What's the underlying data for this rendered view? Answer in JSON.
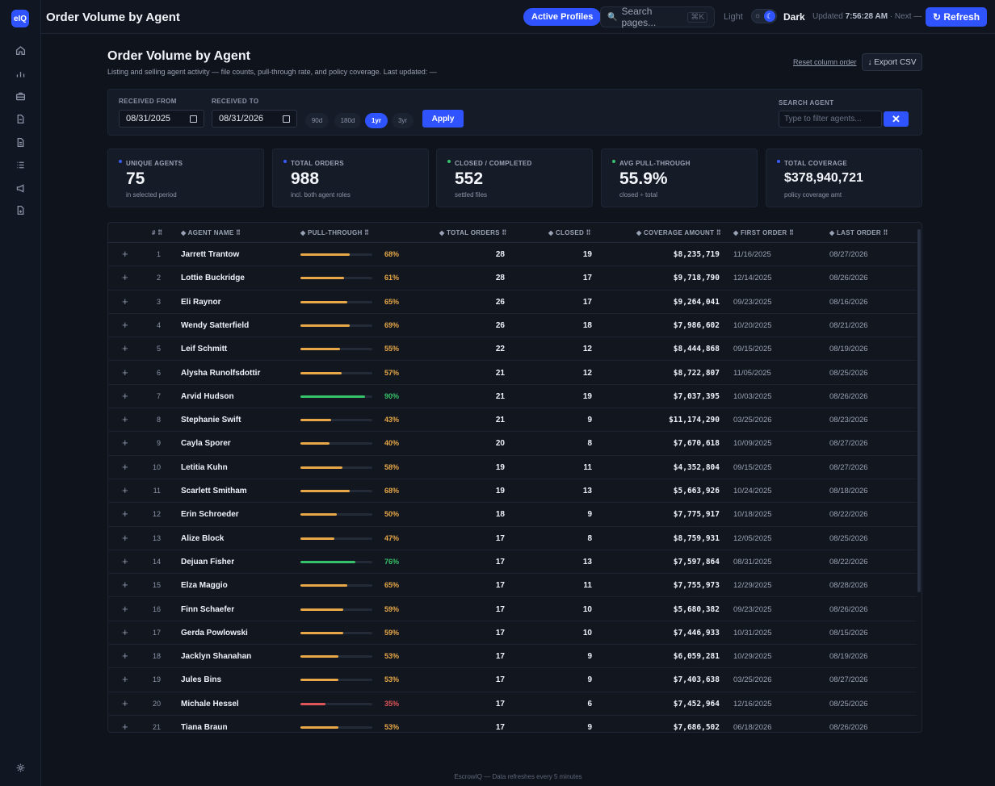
{
  "app": {
    "logo": "eIQ",
    "title": "Order Volume by Agent"
  },
  "sidebar": {
    "icons": [
      "home-icon",
      "chart-icon",
      "briefcase-icon",
      "file-icon",
      "document-icon",
      "list-icon",
      "megaphone-icon",
      "report-icon"
    ],
    "bottom_icon": "settings-icon"
  },
  "topbar": {
    "active_profiles_label": "Active Profiles",
    "search_placeholder": "Search pages...",
    "search_shortcut": "⌘K",
    "theme_light": "Light",
    "theme_dark": "Dark",
    "updated_prefix": "Updated",
    "updated_time": "7:56:28 AM",
    "updated_suffix": "· Next —",
    "refresh_label": "↻ Refresh"
  },
  "header": {
    "title": "Order Volume by Agent",
    "subtitle": "Listing and selling agent activity — file counts, pull-through rate, and policy coverage. Last updated: —",
    "reset_label": "Reset column order",
    "export_label": "↓ Export CSV"
  },
  "filters": {
    "from_label": "RECEIVED FROM",
    "from_value": "08/31/2025",
    "to_label": "RECEIVED TO",
    "to_value": "08/31/2026",
    "ranges": [
      "90d",
      "180d",
      "1yr",
      "3yr"
    ],
    "active_range": "1yr",
    "apply_label": "Apply",
    "search_label": "SEARCH AGENT",
    "search_placeholder": "Type to filter agents...",
    "clear_label": "✕"
  },
  "stats": [
    {
      "label": "UNIQUE AGENTS",
      "value": "75",
      "sub": "in selected period",
      "color": "#3b5bff"
    },
    {
      "label": "TOTAL ORDERS",
      "value": "988",
      "sub": "incl. both agent roles",
      "color": "#3b5bff"
    },
    {
      "label": "CLOSED / COMPLETED",
      "value": "552",
      "sub": "settled files",
      "color": "#36c26b"
    },
    {
      "label": "AVG PULL-THROUGH",
      "value": "55.9%",
      "sub": "closed ÷ total",
      "color": "#36c26b"
    },
    {
      "label": "TOTAL COVERAGE",
      "value": "$378,940,721",
      "sub": "policy coverage amt",
      "color": "#3b5bff"
    }
  ],
  "table": {
    "columns": [
      "# ⠿",
      "◆ AGENT NAME ⠿",
      "◆ PULL-THROUGH ⠿",
      "◆ TOTAL ORDERS ⠿",
      "◆ CLOSED ⠿",
      "◆ COVERAGE AMOUNT ⠿",
      "◆ FIRST ORDER ⠿",
      "◆ LAST ORDER ⠿"
    ],
    "expand_symbol": "+",
    "rows": [
      {
        "n": "1",
        "name": "Jarrett Trantow",
        "pct": 68,
        "pct_label": "68%",
        "total": "28",
        "closed": "19",
        "coverage": "$8,235,719",
        "first": "11/16/2025",
        "last": "08/27/2026"
      },
      {
        "n": "2",
        "name": "Lottie Buckridge",
        "pct": 61,
        "pct_label": "61%",
        "total": "28",
        "closed": "17",
        "coverage": "$9,718,790",
        "first": "12/14/2025",
        "last": "08/26/2026"
      },
      {
        "n": "3",
        "name": "Eli Raynor",
        "pct": 65,
        "pct_label": "65%",
        "total": "26",
        "closed": "17",
        "coverage": "$9,264,041",
        "first": "09/23/2025",
        "last": "08/16/2026"
      },
      {
        "n": "4",
        "name": "Wendy Satterfield",
        "pct": 69,
        "pct_label": "69%",
        "total": "26",
        "closed": "18",
        "coverage": "$7,986,602",
        "first": "10/20/2025",
        "last": "08/21/2026"
      },
      {
        "n": "5",
        "name": "Leif Schmitt",
        "pct": 55,
        "pct_label": "55%",
        "total": "22",
        "closed": "12",
        "coverage": "$8,444,868",
        "first": "09/15/2025",
        "last": "08/19/2026"
      },
      {
        "n": "6",
        "name": "Alysha Runolfsdottir",
        "pct": 57,
        "pct_label": "57%",
        "total": "21",
        "closed": "12",
        "coverage": "$8,722,807",
        "first": "11/05/2025",
        "last": "08/25/2026"
      },
      {
        "n": "7",
        "name": "Arvid Hudson",
        "pct": 90,
        "pct_label": "90%",
        "total": "21",
        "closed": "19",
        "coverage": "$7,037,395",
        "first": "10/03/2025",
        "last": "08/26/2026"
      },
      {
        "n": "8",
        "name": "Stephanie Swift",
        "pct": 43,
        "pct_label": "43%",
        "total": "21",
        "closed": "9",
        "coverage": "$11,174,290",
        "first": "03/25/2026",
        "last": "08/23/2026"
      },
      {
        "n": "9",
        "name": "Cayla Sporer",
        "pct": 40,
        "pct_label": "40%",
        "total": "20",
        "closed": "8",
        "coverage": "$7,670,618",
        "first": "10/09/2025",
        "last": "08/27/2026"
      },
      {
        "n": "10",
        "name": "Letitia Kuhn",
        "pct": 58,
        "pct_label": "58%",
        "total": "19",
        "closed": "11",
        "coverage": "$4,352,804",
        "first": "09/15/2025",
        "last": "08/27/2026"
      },
      {
        "n": "11",
        "name": "Scarlett Smitham",
        "pct": 68,
        "pct_label": "68%",
        "total": "19",
        "closed": "13",
        "coverage": "$5,663,926",
        "first": "10/24/2025",
        "last": "08/18/2026"
      },
      {
        "n": "12",
        "name": "Erin Schroeder",
        "pct": 50,
        "pct_label": "50%",
        "total": "18",
        "closed": "9",
        "coverage": "$7,775,917",
        "first": "10/18/2025",
        "last": "08/22/2026"
      },
      {
        "n": "13",
        "name": "Alize Block",
        "pct": 47,
        "pct_label": "47%",
        "total": "17",
        "closed": "8",
        "coverage": "$8,759,931",
        "first": "12/05/2025",
        "last": "08/25/2026"
      },
      {
        "n": "14",
        "name": "Dejuan Fisher",
        "pct": 76,
        "pct_label": "76%",
        "total": "17",
        "closed": "13",
        "coverage": "$7,597,864",
        "first": "08/31/2025",
        "last": "08/22/2026"
      },
      {
        "n": "15",
        "name": "Elza Maggio",
        "pct": 65,
        "pct_label": "65%",
        "total": "17",
        "closed": "11",
        "coverage": "$7,755,973",
        "first": "12/29/2025",
        "last": "08/28/2026"
      },
      {
        "n": "16",
        "name": "Finn Schaefer",
        "pct": 59,
        "pct_label": "59%",
        "total": "17",
        "closed": "10",
        "coverage": "$5,680,382",
        "first": "09/23/2025",
        "last": "08/26/2026"
      },
      {
        "n": "17",
        "name": "Gerda Powlowski",
        "pct": 59,
        "pct_label": "59%",
        "total": "17",
        "closed": "10",
        "coverage": "$7,446,933",
        "first": "10/31/2025",
        "last": "08/15/2026"
      },
      {
        "n": "18",
        "name": "Jacklyn Shanahan",
        "pct": 53,
        "pct_label": "53%",
        "total": "17",
        "closed": "9",
        "coverage": "$6,059,281",
        "first": "10/29/2025",
        "last": "08/19/2026"
      },
      {
        "n": "19",
        "name": "Jules Bins",
        "pct": 53,
        "pct_label": "53%",
        "total": "17",
        "closed": "9",
        "coverage": "$7,403,638",
        "first": "03/25/2026",
        "last": "08/27/2026"
      },
      {
        "n": "20",
        "name": "Michale Hessel",
        "pct": 35,
        "pct_label": "35%",
        "total": "17",
        "closed": "6",
        "coverage": "$7,452,964",
        "first": "12/16/2025",
        "last": "08/25/2026"
      },
      {
        "n": "21",
        "name": "Tiana Braun",
        "pct": 53,
        "pct_label": "53%",
        "total": "17",
        "closed": "9",
        "coverage": "$7,686,502",
        "first": "06/18/2026",
        "last": "08/26/2026"
      }
    ]
  },
  "colors": {
    "accent": "#2f54ff",
    "good": "#36c26b",
    "mid": "#e8a848",
    "bad": "#e0555a"
  },
  "footer": "EscrowIQ — Data refreshes every 5 minutes"
}
